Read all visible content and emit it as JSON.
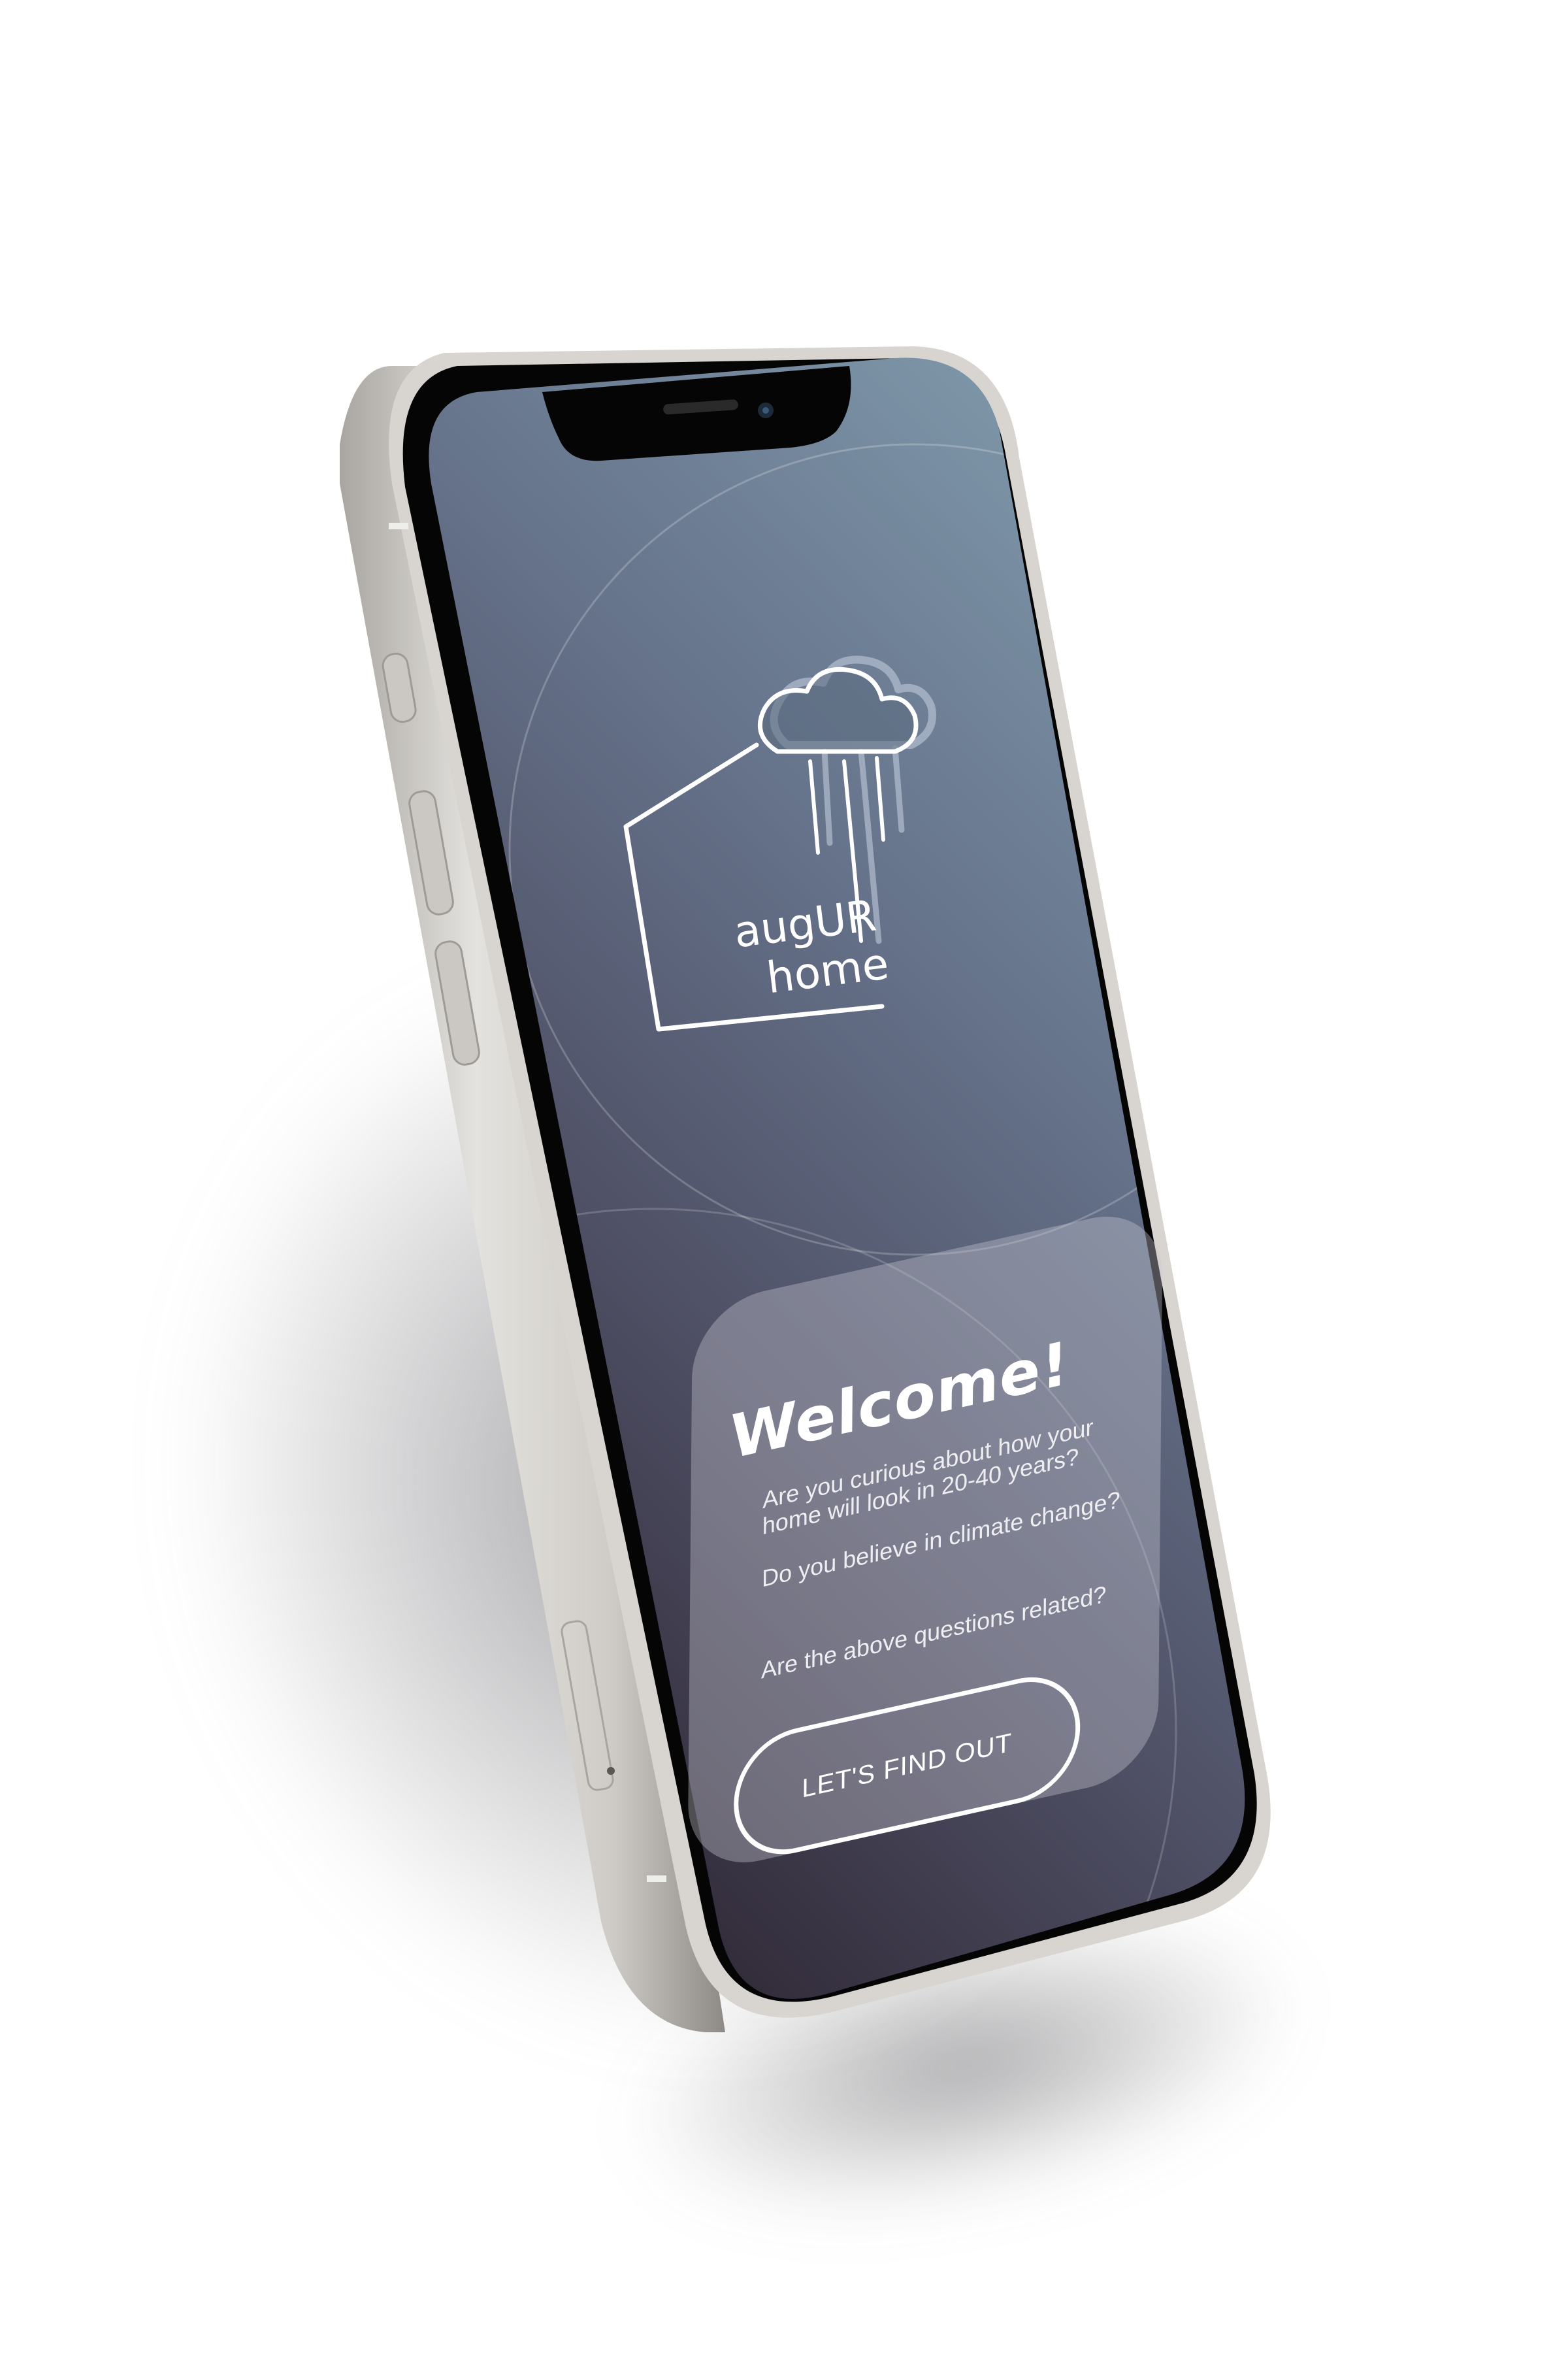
{
  "app": {
    "logo": {
      "line1": "augUR",
      "line2": "home",
      "icon_name": "house-with-rain-cloud-icon"
    }
  },
  "welcome_card": {
    "title": "Welcome!",
    "paragraph1": "Are you curious about how your home will look in 20-40 years?",
    "paragraph2": "Do you believe in climate change?",
    "paragraph3": "Are the above questions related?",
    "cta_label": "LET'S FIND OUT"
  },
  "colors": {
    "screen_top": "#7e94a5",
    "screen_bottom": "#2e2733",
    "frame": "#c9c6c1",
    "bezel": "#000000",
    "accent": "#ffffff"
  }
}
